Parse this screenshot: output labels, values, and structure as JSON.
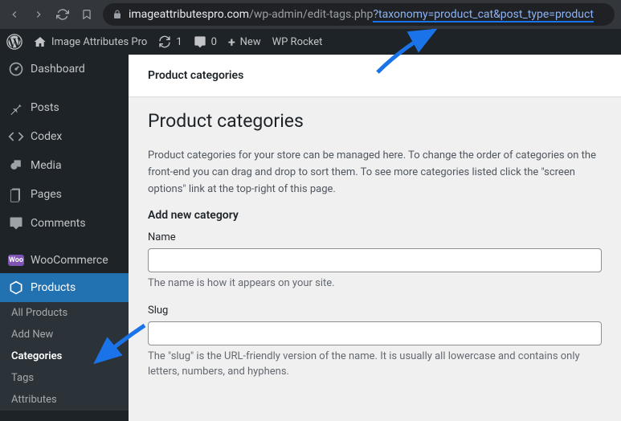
{
  "browser": {
    "url_domain": "imageattributespro.com",
    "url_path": "/wp-admin/edit-tags.php",
    "url_query": "?taxonomy=product_cat&post_type=product"
  },
  "adminbar": {
    "site_title": "Image Attributes Pro",
    "updates": "1",
    "comments": "0",
    "new_label": "New",
    "wprocket_label": "WP Rocket"
  },
  "sidebar": {
    "items": [
      {
        "label": "Dashboard"
      },
      {
        "label": "Posts"
      },
      {
        "label": "Codex"
      },
      {
        "label": "Media"
      },
      {
        "label": "Pages"
      },
      {
        "label": "Comments"
      },
      {
        "label": "WooCommerce"
      },
      {
        "label": "Products"
      }
    ],
    "submenu": [
      {
        "label": "All Products"
      },
      {
        "label": "Add New"
      },
      {
        "label": "Categories"
      },
      {
        "label": "Tags"
      },
      {
        "label": "Attributes"
      }
    ]
  },
  "page": {
    "header_title": "Product categories",
    "title": "Product categories",
    "intro": "Product categories for your store can be managed here. To change the order of categories on the front-end you can drag and drop to sort them. To see more categories listed click the \"screen options\" link at the top-right of this page.",
    "form_heading": "Add new category",
    "name_label": "Name",
    "name_help": "The name is how it appears on your site.",
    "slug_label": "Slug",
    "slug_help": "The \"slug\" is the URL-friendly version of the name. It is usually all lowercase and contains only letters, numbers, and hyphens."
  }
}
